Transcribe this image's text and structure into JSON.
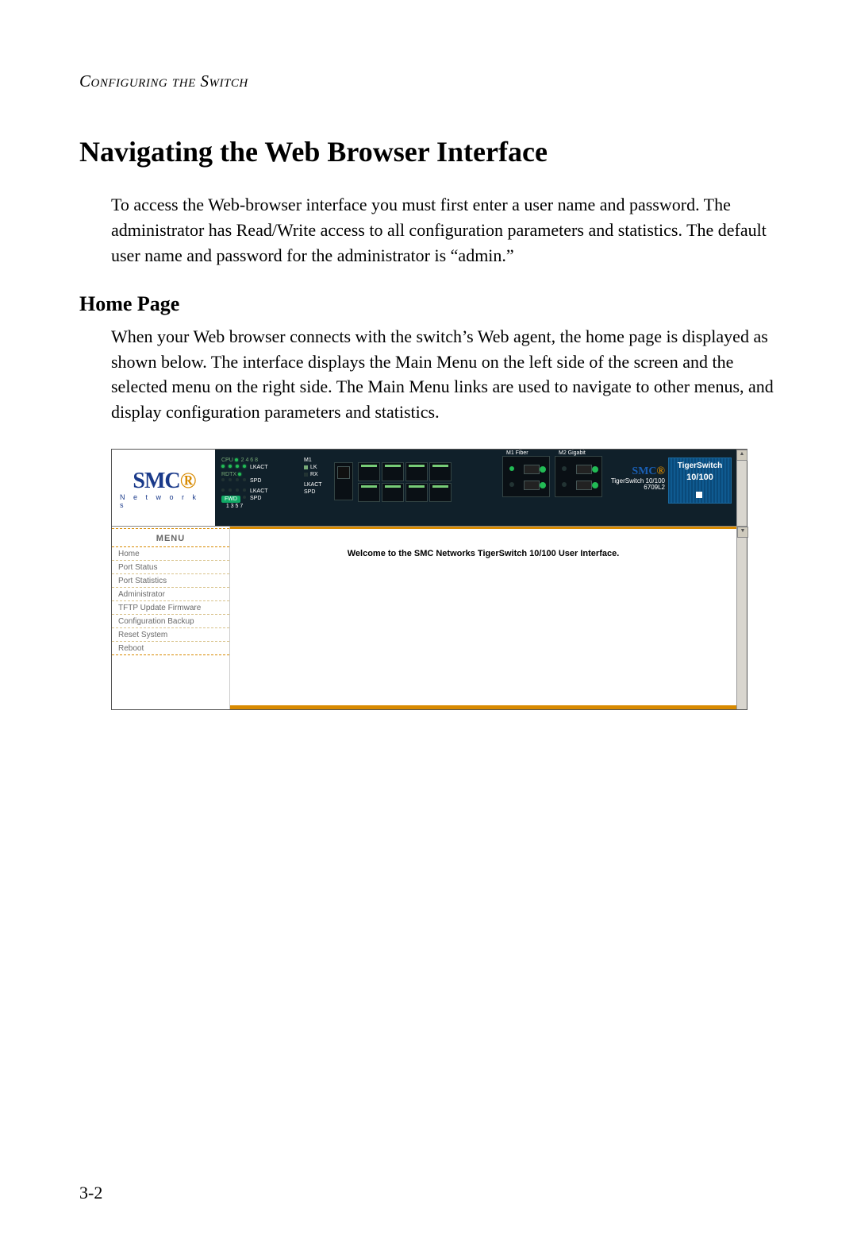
{
  "running_head": "Configuring the Switch",
  "title": "Navigating the Web Browser Interface",
  "intro": "To access the Web-browser interface you must first enter a user name and password. The administrator has Read/Write access to all configuration parameters and statistics. The default user name and password for the administrator is “admin.”",
  "section_h2": "Home Page",
  "section_body": "When your Web browser connects with the switch’s Web agent, the home page is displayed as shown below. The interface displays the Main Menu on the left side of the screen and the selected menu on the right side. The Main Menu links are used to navigate to other menus, and display configuration parameters and statistics.",
  "page_number": "3-2",
  "screenshot": {
    "logo": {
      "brand": "SMC",
      "sub": "N  e  t  w  o  r  k  s"
    },
    "device_panel": {
      "cpu_label": "CPU",
      "rdtx_label": "RDTX",
      "numbers_top": "2  4  6  8",
      "numbers_bot": "1  3  5  7",
      "fwd_btn": "FWD",
      "lkact": "LKACT",
      "spd": "SPD",
      "m1": "M1",
      "lk": "LK",
      "rx": "RX",
      "m1_fiber": "M1 Fiber",
      "m2_gigabit": "M2 Gigabit",
      "brand2": "SMC",
      "brand2_line1": "TigerSwitch 10/100",
      "brand2_line2": "6709L2",
      "tiger_logo_l1": "TigerSwitch",
      "tiger_logo_l2": "10/100"
    },
    "menu": {
      "header": "MENU",
      "items": [
        "Home",
        "Port Status",
        "Port Statistics",
        "Administrator",
        "TFTP Update Firmware",
        "Configuration Backup",
        "Reset System",
        "Reboot"
      ]
    },
    "main": {
      "welcome": "Welcome to the SMC Networks TigerSwitch 10/100 User Interface."
    }
  }
}
